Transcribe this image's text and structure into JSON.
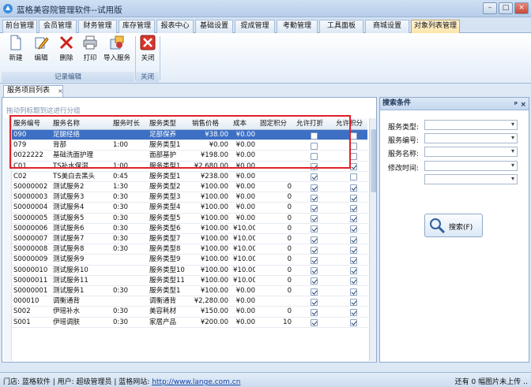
{
  "app": {
    "title": "蓝格美容院管理软件--试用版"
  },
  "menu_tabs": [
    "前台管理",
    "会员管理",
    "财务管理",
    "库存管理",
    "报表中心",
    "基础设置",
    "提成管理",
    "考勤管理",
    "工具面板",
    "商城设置",
    "对象列表管理"
  ],
  "active_tab": "对象列表管理",
  "ribbon": {
    "buttons": [
      {
        "label": "新建",
        "icon": "new-document-icon"
      },
      {
        "label": "编辑",
        "icon": "edit-pencil-icon"
      },
      {
        "label": "删除",
        "icon": "delete-x-icon"
      },
      {
        "label": "打印",
        "icon": "printer-icon"
      },
      {
        "label": "导入服务",
        "icon": "import-icon"
      },
      {
        "label": "关闭",
        "icon": "close-red-icon"
      }
    ],
    "groups": [
      "记录编辑",
      "关闭"
    ]
  },
  "doc_tab": {
    "label": "服务项目列表",
    "close": "×"
  },
  "grid": {
    "group_hint": "拖动列标题到这进行分组",
    "columns": [
      "服务编号",
      "服务名称",
      "服务时长",
      "服务类型",
      "销售价格",
      "成本",
      "固定积分",
      "允许打折",
      "允许积分"
    ],
    "rows": [
      {
        "id": "090",
        "name": "足腿经络",
        "dur": "",
        "type": "足部保养",
        "price": "¥38.00",
        "cost": "¥0.00",
        "points": "",
        "disc": false,
        "pts": false
      },
      {
        "id": "079",
        "name": "背部",
        "dur": "1:00",
        "type": "服务类型1",
        "price": "¥0.00",
        "cost": "¥0.00",
        "points": "",
        "disc": false,
        "pts": false
      },
      {
        "id": "0022222",
        "name": "基础洗面护理",
        "dur": "",
        "type": "面部基护",
        "price": "¥198.00",
        "cost": "¥0.00",
        "points": "",
        "disc": false,
        "pts": false
      },
      {
        "id": "C01",
        "name": "TS补水保湿",
        "dur": "1:00",
        "type": "服务类型1",
        "price": "¥2,680.00",
        "cost": "¥0.00",
        "points": "",
        "disc": true,
        "pts": true
      },
      {
        "id": "C02",
        "name": "TS美白去黑头",
        "dur": "0:45",
        "type": "服务类型1",
        "price": "¥238.00",
        "cost": "¥0.00",
        "points": "",
        "disc": true,
        "pts": false
      },
      {
        "id": "S0000002",
        "name": "测试服务2",
        "dur": "1:30",
        "type": "服务类型2",
        "price": "¥100.00",
        "cost": "¥0.00",
        "points": "0",
        "disc": true,
        "pts": true
      },
      {
        "id": "S0000003",
        "name": "测试服务3",
        "dur": "0:30",
        "type": "服务类型3",
        "price": "¥100.00",
        "cost": "¥0.00",
        "points": "0",
        "disc": true,
        "pts": true
      },
      {
        "id": "S0000004",
        "name": "测试服务4",
        "dur": "0:30",
        "type": "服务类型4",
        "price": "¥100.00",
        "cost": "¥0.00",
        "points": "0",
        "disc": true,
        "pts": true
      },
      {
        "id": "S0000005",
        "name": "测试服务5",
        "dur": "0:30",
        "type": "服务类型5",
        "price": "¥100.00",
        "cost": "¥0.00",
        "points": "0",
        "disc": true,
        "pts": true
      },
      {
        "id": "S0000006",
        "name": "测试服务6",
        "dur": "0:30",
        "type": "服务类型6",
        "price": "¥100.00",
        "cost": "¥10.00",
        "points": "0",
        "disc": true,
        "pts": true
      },
      {
        "id": "S0000007",
        "name": "测试服务7",
        "dur": "0:30",
        "type": "服务类型7",
        "price": "¥100.00",
        "cost": "¥10.00",
        "points": "0",
        "disc": true,
        "pts": true
      },
      {
        "id": "S0000008",
        "name": "测试服务8",
        "dur": "0:30",
        "type": "服务类型8",
        "price": "¥100.00",
        "cost": "¥10.00",
        "points": "0",
        "disc": true,
        "pts": true
      },
      {
        "id": "S0000009",
        "name": "测试服务9",
        "dur": "",
        "type": "服务类型9",
        "price": "¥100.00",
        "cost": "¥10.00",
        "points": "0",
        "disc": true,
        "pts": true
      },
      {
        "id": "S0000010",
        "name": "测试服务10",
        "dur": "",
        "type": "服务类型10",
        "price": "¥100.00",
        "cost": "¥10.00",
        "points": "0",
        "disc": true,
        "pts": true
      },
      {
        "id": "S0000011",
        "name": "测试服务11",
        "dur": "",
        "type": "服务类型11",
        "price": "¥100.00",
        "cost": "¥10.00",
        "points": "0",
        "disc": true,
        "pts": true
      },
      {
        "id": "S0000001",
        "name": "测试服务1",
        "dur": "0:30",
        "type": "服务类型1",
        "price": "¥100.00",
        "cost": "¥0.00",
        "points": "0",
        "disc": true,
        "pts": true
      },
      {
        "id": "000010",
        "name": "调衡通背",
        "dur": "",
        "type": "调衡通背",
        "price": "¥2,280.00",
        "cost": "¥0.00",
        "points": "",
        "disc": true,
        "pts": true
      },
      {
        "id": "S002",
        "name": "伊瑶补水",
        "dur": "0:30",
        "type": "美容耗材",
        "price": "¥150.00",
        "cost": "¥0.00",
        "points": "0",
        "disc": true,
        "pts": true
      },
      {
        "id": "S001",
        "name": "伊瑶调肤",
        "dur": "0:30",
        "type": "家居产品",
        "price": "¥200.00",
        "cost": "¥0.00",
        "points": "10",
        "disc": true,
        "pts": true
      }
    ]
  },
  "search_panel": {
    "title": "搜索条件",
    "pin": "ᵖ",
    "close": "×",
    "fields": [
      "服务类型:",
      "服务编号:",
      "服务名称:",
      "修改时间:"
    ],
    "button": "搜索(F)"
  },
  "status": {
    "left": "门店: 蓝格软件 | 用户: 超级管理员 | 蓝格网站: ",
    "url": "http://www.lange.com.cn",
    "right": "还有 0 幅图片未上传 ‥"
  },
  "colors": {
    "accent": "#3d6fc4",
    "highlight": "#e0202a",
    "brand_bar": "#b6cde9"
  }
}
